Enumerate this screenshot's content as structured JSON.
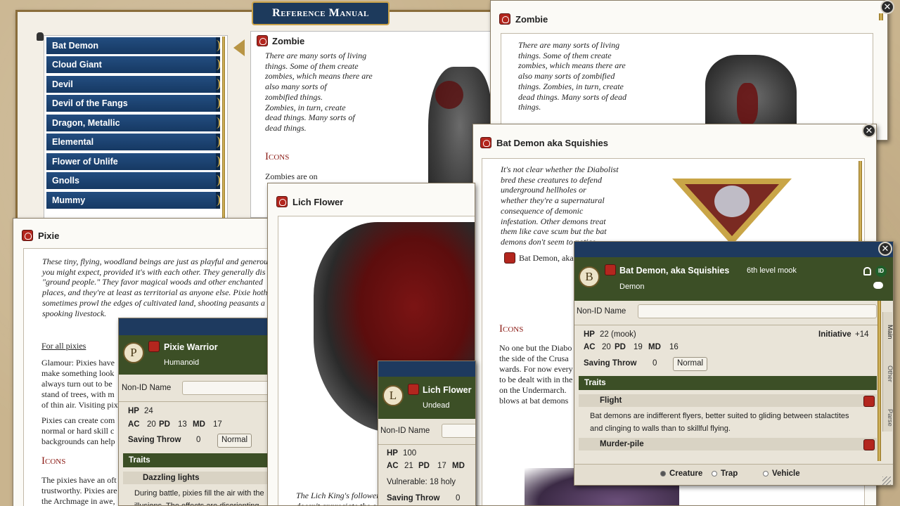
{
  "reference_manual": {
    "title": "Reference Manual",
    "list": [
      "Bat Demon",
      "Cloud Giant",
      "Devil",
      "Devil of the Fangs",
      "Dragon, Metallic",
      "Elemental",
      "Flower of Unlife",
      "Gnolls",
      "Mummy"
    ],
    "zombie_title": "Zombie",
    "zombie_text": "There are many sorts of living\nthings. Some of them create\nzombies, which means there are\nalso many sorts of\nzombified things.\nZombies, in turn, create\ndead things. Many sorts of\ndead things.",
    "icons_heading": "Icons",
    "icons_text": "Zombies are on"
  },
  "zombie_window": {
    "title": "Zombie",
    "text": "There are many sorts of living\nthings. Some of them create\nzombies, which means there are\nalso many sorts of zombified\nthings. Zombies, in turn, create\ndead things. Many sorts of dead\nthings."
  },
  "bat_demon_window": {
    "title": "Bat Demon aka Squishies",
    "intro": "It's not clear whether the Diabolist\nbred these creatures to defend\nunderground hellholes or\nwhether they're a supernatural\nconsequence of demonic\ninfestation. Other demons treat\nthem like cave scum but the bat\ndemons don't seem to notice.",
    "link_label": "Bat Demon, aka",
    "icons_heading": "Icons",
    "icons_text": "No one but the Diabo\nthe side of the Crusa\nwards. For now every\nto be dealt with in the\non the Undermarch.\nblows at bat demons"
  },
  "pixie_window": {
    "title": "Pixie",
    "intro": "These tiny, flying, woodland beings are just as playful and generou\nyou might expect, provided it's with each other. They generally dis\n\"ground people.\" They favor magical woods and other enchanted\nplaces, and they're at least as territorial as anyone else. Pixie hoth\nsometimes prowl the edges of cultivated land, shooting peasants a\nspooking livestock.",
    "for_all": "For all pixies",
    "glamour": "Glamour: Pixies have\nmake something look\nalways turn out to be\nstand of trees, with m\nof thin air. Visiting pix",
    "create": "Pixies can create com\nnormal or hard skill c\nbackgrounds can help",
    "icons_heading": "Icons",
    "icons_text": "The pixies have an oft\ntrustworthy. Pixies are\nthe Archmage in awe,"
  },
  "lich_window": {
    "title": "Lich Flower",
    "caption": "The Lich King's followers\ndoesn't appreciate the c"
  },
  "pixie_sheet": {
    "letter": "P",
    "name": "Pixie Warrior",
    "type": "Humanoid",
    "nonid_label": "Non-ID Name",
    "hp_label": "HP",
    "hp": "24",
    "ac_label": "AC",
    "ac": "20",
    "pd_label": "PD",
    "pd": "13",
    "md_label": "MD",
    "md": "17",
    "save_label": "Saving Throw",
    "save": "0",
    "normal": "Normal",
    "traits": "Traits",
    "trait1": "Dazzling lights",
    "trait1_desc": "During battle, pixies fill the air with the\nillusions. The effects are disorienting"
  },
  "lich_sheet": {
    "letter": "L",
    "name": "Lich Flower",
    "type": "Undead",
    "nonid_label": "Non-ID Name",
    "hp_label": "HP",
    "hp": "100",
    "ac_label": "AC",
    "ac": "21",
    "pd_label": "PD",
    "pd": "17",
    "md_label": "MD",
    "vuln": "Vulnerable: 18 holy",
    "save_label": "Saving Throw",
    "save": "0"
  },
  "bat_sheet": {
    "letter": "B",
    "name": "Bat Demon, aka Squishies",
    "level": "6th level mook",
    "type": "Demon",
    "id_badge": "ID",
    "nonid_label": "Non-ID Name",
    "hp_label": "HP",
    "hp": "22 (mook)",
    "init_label": "Initiative",
    "init": "+14",
    "ac_label": "AC",
    "ac": "20",
    "pd_label": "PD",
    "pd": "19",
    "md_label": "MD",
    "md": "16",
    "save_label": "Saving Throw",
    "save": "0",
    "normal": "Normal",
    "traits": "Traits",
    "trait1": "Flight",
    "trait1_desc": "Bat demons are indifferent flyers, better suited to gliding between stalactites\nand clinging to walls than to skillful flying.",
    "trait2": "Murder-pile",
    "tabs": [
      "Main",
      "Other",
      "Parse"
    ],
    "radio_creature": "Creature",
    "radio_trap": "Trap",
    "radio_vehicle": "Vehicle"
  },
  "colors": {
    "header_green": "#3c4f26",
    "list_blue": "#1e4a7a",
    "title_red": "#b3261e",
    "manual_banner": "#1d3a5c"
  }
}
